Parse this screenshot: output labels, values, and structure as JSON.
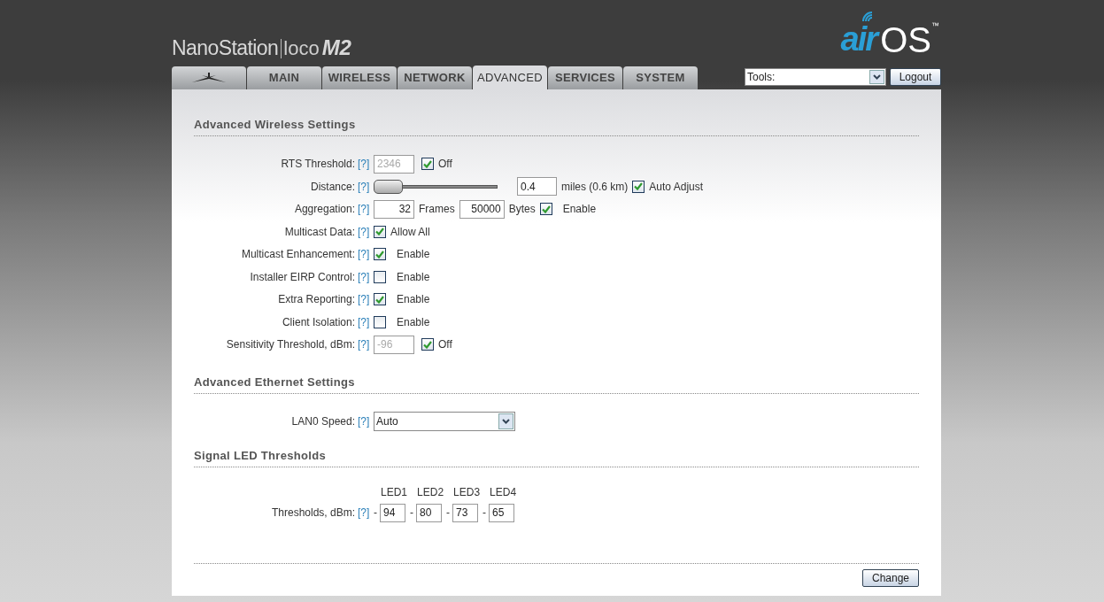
{
  "header": {
    "product": {
      "name": "NanoStation",
      "line": "loco",
      "model": "M2"
    },
    "brand": {
      "prefix": "air",
      "name": "OS",
      "mark": "™"
    }
  },
  "tabs": [
    {
      "kind": "icon",
      "selected": false
    },
    {
      "kind": "text",
      "label": "MAIN",
      "selected": false
    },
    {
      "kind": "text",
      "label": "WIRELESS",
      "selected": false
    },
    {
      "kind": "text",
      "label": "NETWORK",
      "selected": false
    },
    {
      "kind": "text",
      "label": "ADVANCED",
      "selected": true
    },
    {
      "kind": "text",
      "label": "SERVICES",
      "selected": false
    },
    {
      "kind": "text",
      "label": "SYSTEM",
      "selected": false
    }
  ],
  "tools": {
    "value": "Tools:"
  },
  "logout": "Logout",
  "sections": [
    {
      "title": "Advanced Wireless Settings",
      "rows": [
        {
          "label": "RTS Threshold:",
          "help": "[?]",
          "controls": [
            {
              "kind": "field",
              "value": "2346",
              "disabled": true
            },
            {
              "kind": "checkbox",
              "checked": true,
              "label": "Off"
            }
          ]
        },
        {
          "label": "Distance:",
          "help": "[?]",
          "controls": [
            {
              "kind": "slider",
              "level": 0
            },
            {
              "kind": "wide_field",
              "value": "0.4",
              "disabled": false
            },
            {
              "kind": "text",
              "text": "miles (0.6 km)"
            },
            {
              "kind": "checkbox",
              "checked": true,
              "label": "Auto Adjust"
            }
          ]
        },
        {
          "label": "Aggregation:",
          "help": "[?]",
          "controls": [
            {
              "kind": "count_field",
              "value": "32",
              "disabled": false
            },
            {
              "kind": "text",
              "text": "Frames"
            },
            {
              "kind": "count_field",
              "value": "50000",
              "disabled": false
            },
            {
              "kind": "text",
              "text": "Bytes"
            },
            {
              "kind": "checkbox",
              "checked": true,
              "label": "Enable"
            }
          ]
        },
        {
          "label": "Multicast Data:",
          "help": "[?]",
          "controls": [
            {
              "kind": "checkbox",
              "checked": true,
              "label": "Allow All"
            }
          ]
        },
        {
          "label": "Multicast Enhancement:",
          "help": "[?]",
          "controls": [
            {
              "kind": "checkbox",
              "checked": true,
              "label": "Enable"
            }
          ]
        },
        {
          "label": "Installer EIRP Control:",
          "help": "[?]",
          "controls": [
            {
              "kind": "checkbox",
              "checked": false,
              "label": "Enable"
            }
          ]
        },
        {
          "label": "Extra Reporting:",
          "help": "[?]",
          "controls": [
            {
              "kind": "checkbox",
              "checked": true,
              "label": "Enable"
            }
          ]
        },
        {
          "label": "Client Isolation:",
          "help": "[?]",
          "controls": [
            {
              "kind": "checkbox",
              "checked": false,
              "label": "Enable"
            }
          ]
        },
        {
          "label": "Sensitivity Threshold, dBm:",
          "help": "[?]",
          "controls": [
            {
              "kind": "field",
              "value": "-96",
              "disabled": true
            },
            {
              "kind": "checkbox",
              "checked": true,
              "label": "Off"
            }
          ]
        }
      ]
    },
    {
      "title": "Advanced Ethernet Settings",
      "rows": [
        {
          "label": "LAN0 Speed:",
          "help": "[?]",
          "controls": [
            {
              "kind": "select",
              "value": "Auto"
            }
          ]
        }
      ]
    },
    {
      "title": "Signal LED Thresholds",
      "rows": [
        {
          "label": "Thresholds, dBm:",
          "help": "[?]",
          "controls": [
            {
              "kind": "leds",
              "leds": [
                {
                  "name": "LED1",
                  "prefix": "-",
                  "value": "94"
                },
                {
                  "name": "LED2",
                  "prefix": "-",
                  "value": "80"
                },
                {
                  "name": "LED3",
                  "prefix": "-",
                  "value": "73"
                },
                {
                  "name": "LED4",
                  "prefix": "-",
                  "value": "65"
                }
              ]
            }
          ]
        }
      ]
    }
  ],
  "submit": "Change"
}
